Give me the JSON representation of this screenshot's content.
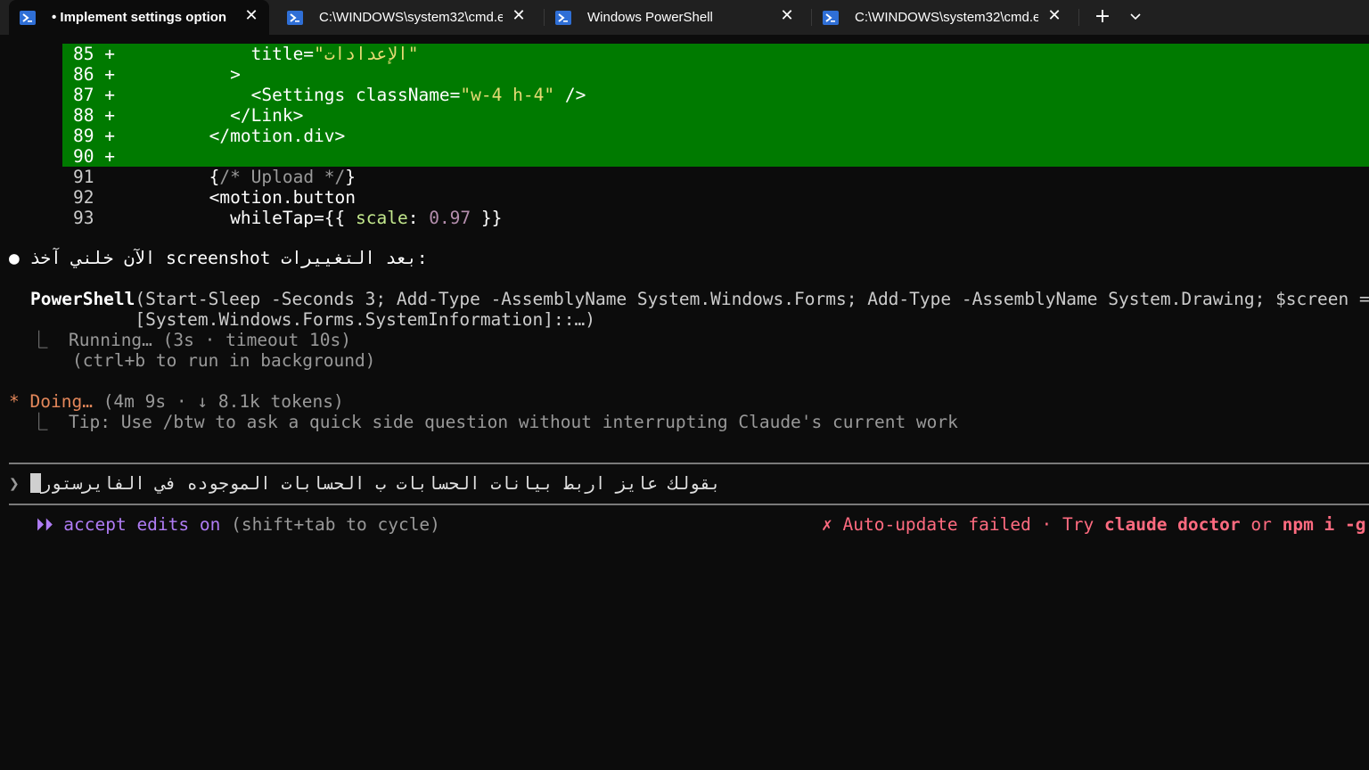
{
  "tabs": [
    {
      "label": "• Implement settings option ·",
      "icon": "powershell-icon",
      "active": true
    },
    {
      "label": "C:\\WINDOWS\\system32\\cmd.e",
      "icon": "powershell-icon",
      "active": false
    },
    {
      "label": "Windows PowerShell",
      "icon": "powershell-icon",
      "active": false
    },
    {
      "label": "C:\\WINDOWS\\system32\\cmd.e",
      "icon": "powershell-icon",
      "active": false
    }
  ],
  "tab_close_glyph": "✕",
  "new_tab_glyph": "+",
  "diff": {
    "lines": [
      {
        "num": "85",
        "sign": "+",
        "indent": "            ",
        "parts": [
          [
            "title=",
            "add"
          ],
          [
            "\"الإعدادات\"",
            "str"
          ]
        ]
      },
      {
        "num": "86",
        "sign": "+",
        "indent": "          ",
        "parts": [
          [
            ">",
            "add"
          ]
        ]
      },
      {
        "num": "87",
        "sign": "+",
        "indent": "            ",
        "parts": [
          [
            "<Settings className=",
            "add"
          ],
          [
            "\"w-4 h-4\"",
            "str"
          ],
          [
            " />",
            "add"
          ]
        ]
      },
      {
        "num": "88",
        "sign": "+",
        "indent": "          ",
        "parts": [
          [
            "</Link>",
            "add"
          ]
        ]
      },
      {
        "num": "89",
        "sign": "+",
        "indent": "        ",
        "parts": [
          [
            "</motion.div>",
            "add"
          ]
        ]
      },
      {
        "num": "90",
        "sign": "+",
        "indent": "",
        "parts": []
      },
      {
        "num": "91",
        "sign": " ",
        "indent": "        ",
        "parts": [
          [
            "{",
            "add"
          ],
          [
            "/* Upload */",
            "cmt"
          ],
          [
            "}",
            "add"
          ]
        ]
      },
      {
        "num": "92",
        "sign": " ",
        "indent": "        ",
        "parts": [
          [
            "<motion.button",
            "add"
          ]
        ]
      },
      {
        "num": "93",
        "sign": " ",
        "indent": "          ",
        "parts": [
          [
            "whileTap={{ ",
            "add"
          ],
          [
            "scale",
            "prop"
          ],
          [
            ": ",
            "add"
          ],
          [
            "0.97",
            "num"
          ],
          [
            " }}",
            "add"
          ]
        ]
      }
    ]
  },
  "message": {
    "bullet": "●",
    "text": "الآن خلني آخذ screenshot بعد التغييرات:"
  },
  "tool_call": {
    "line1_name": "PowerShell",
    "line1_args": "(Start-Sleep -Seconds 3; Add-Type -AssemblyName System.Windows.Forms; Add-Type -AssemblyName System.Drawing; $screen =",
    "line2": "          [System.Windows.Forms.SystemInformation]::…)",
    "status_prefix": "⎿",
    "status": "  Running… (3s · timeout 10s)",
    "hint": "    (ctrl+b to run in background)"
  },
  "progress": {
    "star": "*",
    "label": "Doing…",
    "detail": " (4m 9s · ↓ 8.1k tokens)",
    "tip_prefix": "⎿",
    "tip": "  Tip: Use /btw to ask a quick side question without interrupting Claude's current work"
  },
  "prompt": {
    "chevron": "❯",
    "value": "بقولك عايز اربط بيانات الحسابات ب الحسابات الموجوده في الفايرستور"
  },
  "footer": {
    "mode_icon": "⏵⏵",
    "mode_label": "accept edits on",
    "mode_hint": " (shift+tab to cycle)",
    "error_icon": "✗",
    "error_text": " Auto-update failed · Try ",
    "cmd1": "claude doctor",
    "or": " or ",
    "cmd2": "npm i -g"
  },
  "colors": {
    "diff_add_bg": "#007a00",
    "accent_orange": "#e3875a",
    "mode_purple": "#b07cf5",
    "error_red": "#ff6b80"
  }
}
